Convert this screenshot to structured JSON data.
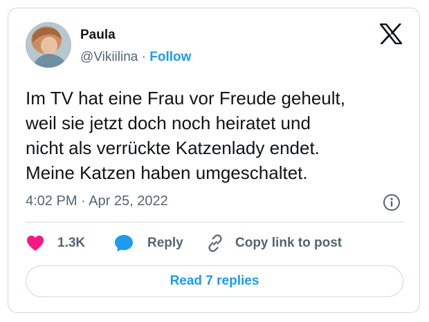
{
  "author": {
    "name": "Paula",
    "handle": "@Vikiilina",
    "separator": " · ",
    "follow_label": "Follow"
  },
  "tweet": {
    "lines": [
      "Im TV hat eine Frau vor Freude geheult,",
      "weil sie jetzt doch noch heiratet und",
      "nicht als verrückte Katzenlady endet.",
      "Meine Katzen haben umgeschaltet."
    ],
    "time": "4:02 PM",
    "meta_separator": " · ",
    "date": "Apr 25, 2022"
  },
  "actions": {
    "like_count": "1.3K",
    "reply_label": "Reply",
    "copy_link_label": "Copy link to post",
    "read_replies_label": "Read 7 replies"
  },
  "icons": {
    "platform_logo": "x-logo-icon",
    "info": "info-icon",
    "like": "heart-icon",
    "reply": "speech-bubble-icon",
    "copy_link": "link-icon"
  },
  "colors": {
    "accent": "#1d9bf0",
    "like": "#f91880",
    "text": "#0f1419",
    "secondary_text": "#536471",
    "border": "#cfd9de"
  }
}
